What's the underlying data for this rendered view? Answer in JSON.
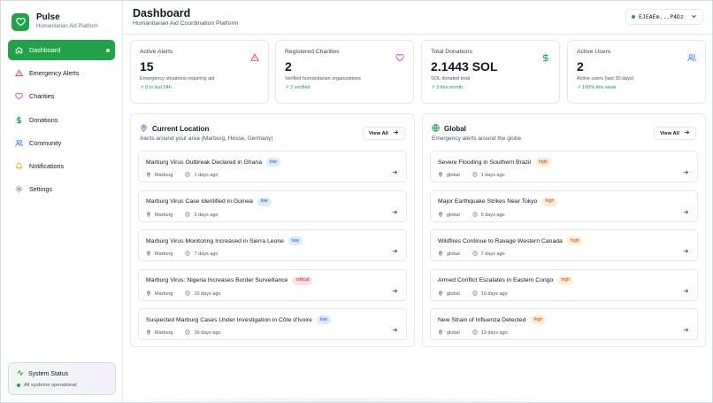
{
  "brand": {
    "name": "Pulse",
    "subtitle": "Humanitarian Aid Platform"
  },
  "sidebar": {
    "items": [
      {
        "label": "Dashboard",
        "icon": "home-icon",
        "active": true
      },
      {
        "label": "Emergency Alerts",
        "icon": "alert-triangle-icon"
      },
      {
        "label": "Charities",
        "icon": "heart-icon"
      },
      {
        "label": "Donations",
        "icon": "dollar-icon"
      },
      {
        "label": "Community",
        "icon": "users-icon"
      },
      {
        "label": "Notifications",
        "icon": "bell-icon"
      },
      {
        "label": "Settings",
        "icon": "gear-icon"
      }
    ],
    "status": {
      "title": "System Status",
      "text": "All systems operational"
    }
  },
  "header": {
    "title": "Dashboard",
    "subtitle": "Humanitarian Aid Coordination Platform",
    "wallet": "EJEAEm...P4Dz"
  },
  "stats": [
    {
      "title": "Active Alerts",
      "value": "15",
      "desc": "Emergency situations requiring aid",
      "trend": "↗ 0 in last 24h",
      "icon": "alert-triangle-icon",
      "color": "#ef4444"
    },
    {
      "title": "Registered Charities",
      "value": "2",
      "desc": "Verified humanitarian organizations",
      "trend": "↗ 2 verified",
      "icon": "heart-icon",
      "color": "#d946ef"
    },
    {
      "title": "Total Donations",
      "value": "2.1443 SOL",
      "desc": "SOL donated total",
      "trend": "↗ 3 this month",
      "icon": "dollar-icon",
      "color": "#16a34a"
    },
    {
      "title": "Active Users",
      "value": "2",
      "desc": "Active users (last 30 days)",
      "trend": "↗ 100% this week",
      "icon": "users-icon",
      "color": "#3b82f6"
    }
  ],
  "local": {
    "title": "Current Location",
    "subtitle": "Alerts around your area (Marburg, Hesse, Germany)",
    "view_all": "View All",
    "alerts": [
      {
        "title": "Marburg Virus Outbreak Declared in Ghana",
        "severity": "low",
        "location": "Marburg",
        "time": "1 days ago"
      },
      {
        "title": "Marburg Virus Case Identified in Guinea",
        "severity": "low",
        "location": "Marburg",
        "time": "3 days ago"
      },
      {
        "title": "Marburg Virus Monitoring Increased in Sierra Leone",
        "severity": "low",
        "location": "Marburg",
        "time": "7 days ago"
      },
      {
        "title": "Marburg Virus: Nigeria Increases Border Surveillance",
        "severity": "critical",
        "location": "Marburg",
        "time": "10 days ago"
      },
      {
        "title": "Suspected Marburg Cases Under Investigation in Côte d'Ivoire",
        "severity": "low",
        "location": "Marburg",
        "time": "16 days ago"
      }
    ]
  },
  "global": {
    "title": "Global",
    "subtitle": "Emergency alerts around the globe",
    "view_all": "View All",
    "alerts": [
      {
        "title": "Severe Flooding in Southern Brazil",
        "severity": "high",
        "location": "global",
        "time": "1 days ago"
      },
      {
        "title": "Major Earthquake Strikes Near Tokyo",
        "severity": "high",
        "location": "global",
        "time": "5 days ago"
      },
      {
        "title": "Wildfires Continue to Ravage Western Canada",
        "severity": "high",
        "location": "global",
        "time": "7 days ago"
      },
      {
        "title": "Armed Conflict Escalates in Eastern Congo",
        "severity": "high",
        "location": "global",
        "time": "10 days ago"
      },
      {
        "title": "New Strain of Influenza Detected",
        "severity": "high",
        "location": "global",
        "time": "13 days ago"
      }
    ]
  },
  "colors": {
    "accent": "#22a34a",
    "low": "#1d4ed8",
    "high": "#c2410c",
    "critical": "#b91c1c"
  }
}
